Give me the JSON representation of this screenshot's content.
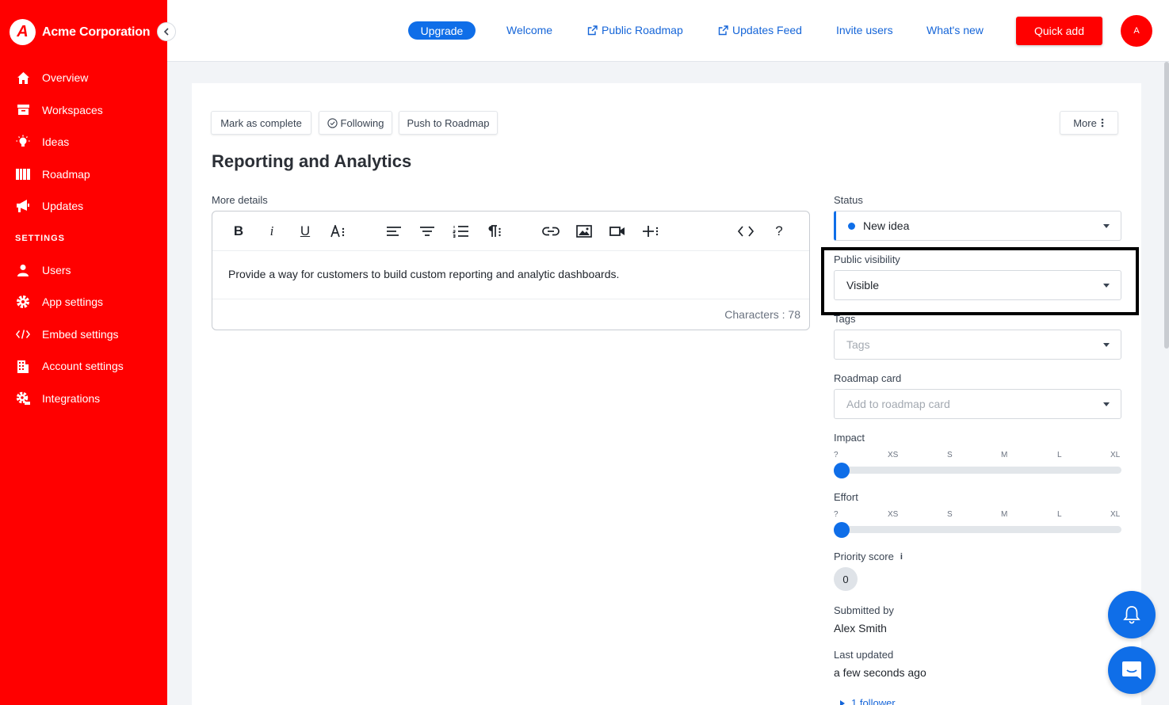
{
  "brand": {
    "name": "Acme Corporation",
    "logo_letter": "A"
  },
  "sidebar": {
    "items": [
      {
        "label": "Overview",
        "icon": "home-icon"
      },
      {
        "label": "Workspaces",
        "icon": "inbox-icon"
      },
      {
        "label": "Ideas",
        "icon": "lightbulb-icon"
      },
      {
        "label": "Roadmap",
        "icon": "columns-icon"
      },
      {
        "label": "Updates",
        "icon": "megaphone-icon"
      }
    ],
    "settings_heading": "SETTINGS",
    "settings_items": [
      {
        "label": "Users",
        "icon": "user-icon"
      },
      {
        "label": "App settings",
        "icon": "gear-icon"
      },
      {
        "label": "Embed settings",
        "icon": "code-icon"
      },
      {
        "label": "Account settings",
        "icon": "building-icon"
      },
      {
        "label": "Integrations",
        "icon": "api-gear-icon"
      }
    ]
  },
  "topbar": {
    "upgrade": "Upgrade",
    "links": [
      "Welcome",
      "Public Roadmap",
      "Updates Feed",
      "Invite users",
      "What's new"
    ],
    "quick_add": "Quick add",
    "avatar_letter": "A"
  },
  "idea": {
    "actions": {
      "complete": "Mark as complete",
      "following": "Following",
      "push": "Push to Roadmap",
      "more": "More"
    },
    "title": "Reporting and Analytics",
    "details_label": "More details",
    "description": "Provide a way for customers to build custom reporting and analytic dashboards.",
    "char_count": "Characters : 78"
  },
  "fields": {
    "status_label": "Status",
    "status_value": "New idea",
    "visibility_label": "Public visibility",
    "visibility_value": "Visible",
    "tags_label": "Tags",
    "tags_placeholder": "Tags",
    "roadmap_label": "Roadmap card",
    "roadmap_placeholder": "Add to roadmap card",
    "impact_label": "Impact",
    "effort_label": "Effort",
    "scale": [
      "?",
      "XS",
      "S",
      "M",
      "L",
      "XL"
    ],
    "impact_value": "?",
    "effort_value": "?",
    "priority_label": "Priority score",
    "priority_value": "0",
    "submitted_label": "Submitted by",
    "submitted_value": "Alex Smith",
    "updated_label": "Last updated",
    "updated_value": "a few seconds ago",
    "followers": "1 follower"
  },
  "colors": {
    "brand": "#ff0000",
    "accent": "#0f6ee8",
    "link": "#1565d8"
  }
}
